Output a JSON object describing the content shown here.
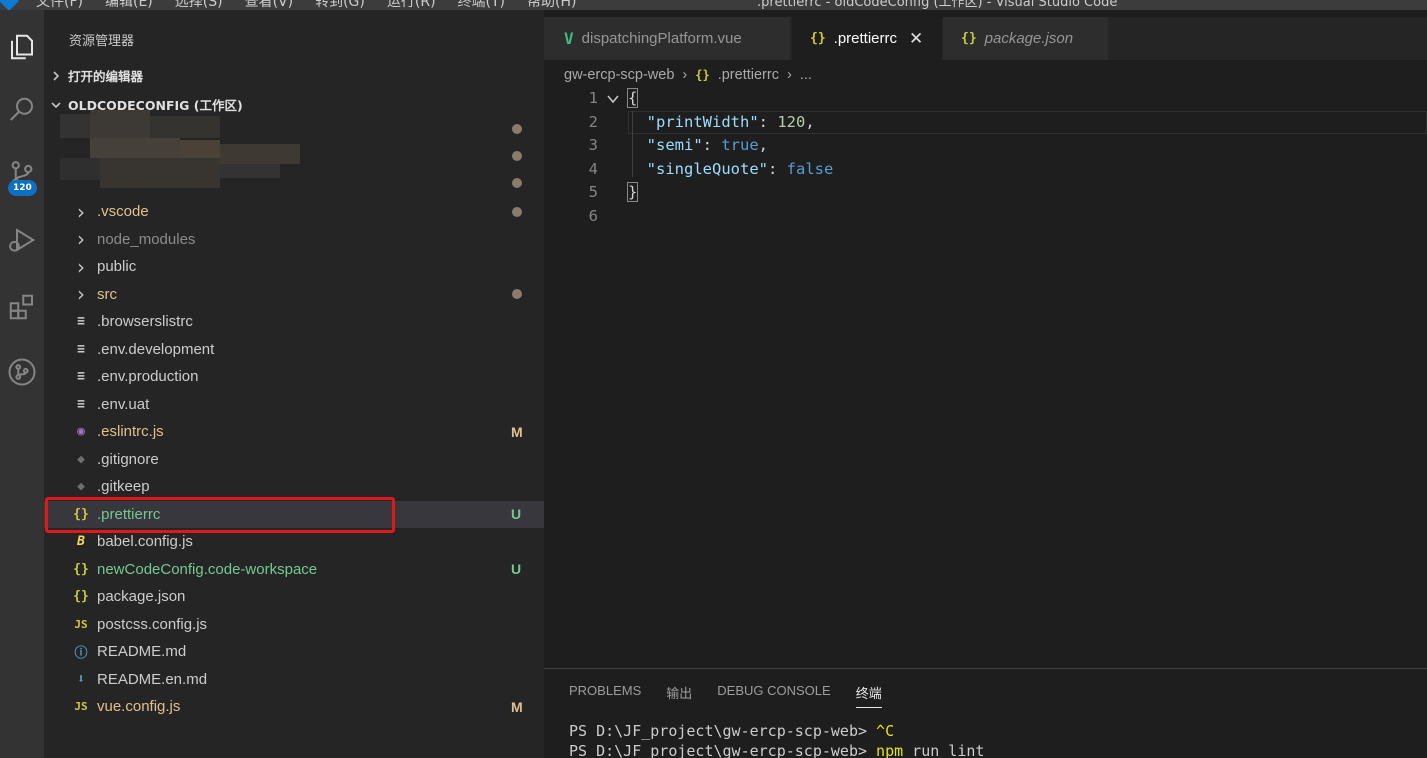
{
  "window": {
    "title": ".prettierrc - oldCodeConfig (工作区) - Visual Studio Code",
    "menu": [
      "文件(F)",
      "编辑(E)",
      "选择(S)",
      "查看(V)",
      "转到(G)",
      "运行(R)",
      "终端(T)",
      "帮助(H)"
    ]
  },
  "activity_bar": {
    "items": [
      {
        "name": "explorer-icon",
        "active": true
      },
      {
        "name": "search-icon"
      },
      {
        "name": "source-control-icon",
        "badge": "120"
      },
      {
        "name": "run-debug-icon"
      },
      {
        "name": "extensions-icon"
      },
      {
        "name": "git-graph-icon"
      }
    ]
  },
  "sidebar": {
    "title": "资源管理器",
    "open_editors": "打开的编辑器",
    "workspace": "OLDCODECONFIG (工作区)",
    "files": [
      {
        "label": ".vscode",
        "kind": "folder",
        "color": "#e2c08d",
        "status_dot": true
      },
      {
        "label": "node_modules",
        "kind": "folder",
        "color": "#8c8c8c"
      },
      {
        "label": "public",
        "kind": "folder",
        "color": "#cccccc"
      },
      {
        "label": "src",
        "kind": "folder",
        "color": "#e2c08d",
        "status_dot": true
      },
      {
        "label": ".browserslistrc",
        "kind": "lines",
        "color": "#cccccc"
      },
      {
        "label": ".env.development",
        "kind": "lines",
        "color": "#cccccc"
      },
      {
        "label": ".env.production",
        "kind": "lines",
        "color": "#cccccc"
      },
      {
        "label": ".env.uat",
        "kind": "lines",
        "color": "#cccccc"
      },
      {
        "label": ".eslintrc.js",
        "kind": "eslint",
        "color": "#e2c08d",
        "status": "M"
      },
      {
        "label": ".gitignore",
        "kind": "git",
        "color": "#cccccc"
      },
      {
        "label": ".gitkeep",
        "kind": "git",
        "color": "#cccccc"
      },
      {
        "label": ".prettierrc",
        "kind": "json",
        "color": "#73c991",
        "status": "U",
        "selected": true
      },
      {
        "label": "babel.config.js",
        "kind": "babel",
        "color": "#cccccc"
      },
      {
        "label": "newCodeConfig.code-workspace",
        "kind": "json",
        "color": "#73c991",
        "status": "U"
      },
      {
        "label": "package.json",
        "kind": "json",
        "color": "#cccccc"
      },
      {
        "label": "postcss.config.js",
        "kind": "js",
        "color": "#cccccc"
      },
      {
        "label": "README.md",
        "kind": "info",
        "color": "#cccccc"
      },
      {
        "label": "README.en.md",
        "kind": "download",
        "color": "#cccccc"
      },
      {
        "label": "vue.config.js",
        "kind": "js",
        "color": "#e2c08d",
        "status": "M"
      }
    ]
  },
  "editor": {
    "tabs": [
      {
        "label": "dispatchingPlatform.vue",
        "icon": "V",
        "active": false
      },
      {
        "label": ".prettierrc",
        "icon": "{}",
        "active": true
      },
      {
        "label": "package.json",
        "icon": "{}",
        "active": false,
        "italic": true
      }
    ],
    "breadcrumb": [
      "gw-ercp-scp-web",
      ".prettierrc",
      "..."
    ],
    "lines": [
      {
        "n": "1",
        "text": "{"
      },
      {
        "n": "2",
        "key": "\"printWidth\"",
        "value": "120",
        "vtype": "num",
        "comma": ","
      },
      {
        "n": "3",
        "key": "\"semi\"",
        "value": "true",
        "vtype": "kw",
        "comma": ","
      },
      {
        "n": "4",
        "key": "\"singleQuote\"",
        "value": "false",
        "vtype": "kw",
        "comma": ""
      },
      {
        "n": "5",
        "text": "}"
      },
      {
        "n": "6",
        "text": ""
      }
    ]
  },
  "panel": {
    "tabs": [
      "PROBLEMS",
      "输出",
      "DEBUG CONSOLE",
      "终端"
    ],
    "active_tab": "终端",
    "terminal": [
      {
        "prompt": "PS D:\\JF_project\\gw-ercp-scp-web> ",
        "cmd": "^C"
      },
      {
        "prompt": "PS D:\\JF_project\\gw-ercp-scp-web> ",
        "cmd": "npm",
        "rest": " run lint"
      }
    ]
  }
}
